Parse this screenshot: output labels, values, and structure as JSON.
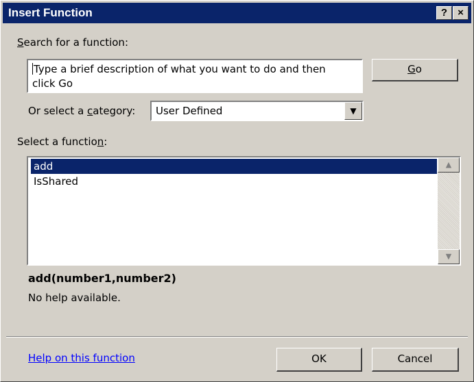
{
  "window": {
    "title": "Insert Function",
    "help_glyph": "?",
    "close_glyph": "×"
  },
  "search": {
    "label_pre": "",
    "label_mnemonic": "S",
    "label_post": "earch for a function:",
    "placeholder_line1": "Type a brief description of what you want to do and then",
    "placeholder_line2": "click Go",
    "go_mnemonic": "G",
    "go_post": "o"
  },
  "category": {
    "label_pre": "Or select a ",
    "label_mnemonic": "c",
    "label_post": "ategory:",
    "selected": "User Defined",
    "dropdown_icon": "chevron-down-icon"
  },
  "function_list": {
    "label_pre": "Select a functio",
    "label_mnemonic": "n",
    "label_post": ":",
    "items": [
      "add",
      "IsShared"
    ],
    "selected_index": 0
  },
  "details": {
    "syntax": "add(number1,number2)",
    "description": "No help available."
  },
  "footer": {
    "help_link": "Help on this function",
    "ok_label": "OK",
    "cancel_label": "Cancel"
  },
  "colors": {
    "titlebar": "#0a246a",
    "face": "#d4d0c8",
    "selection": "#0a246a",
    "link": "#0000ff"
  }
}
